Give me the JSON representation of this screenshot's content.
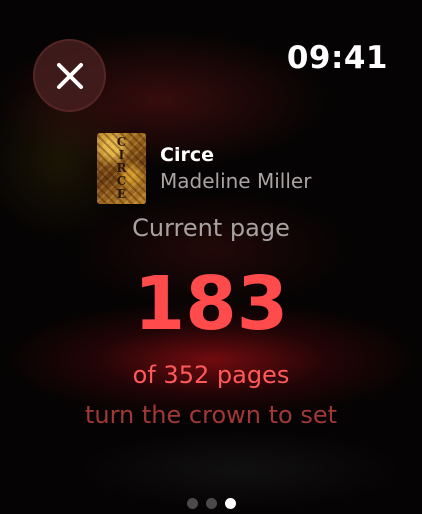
{
  "status": {
    "time": "09:41"
  },
  "close_button": {
    "icon": "close-icon",
    "color": "#FFFFFF"
  },
  "book": {
    "title": "Circe",
    "author": "Madeline Miller",
    "cover_letters": [
      "C",
      "I",
      "R",
      "C",
      "E"
    ]
  },
  "progress": {
    "label": "Current page",
    "current_page": "183",
    "total_text": "of 352 pages",
    "hint": "turn the crown to set",
    "current_value": 183,
    "total_value": 352
  },
  "pager": {
    "count": 3,
    "active_index": 2
  },
  "colors": {
    "accent": "#FF4B4B",
    "background": "#000000",
    "secondary_text": "#A8A2A2"
  }
}
